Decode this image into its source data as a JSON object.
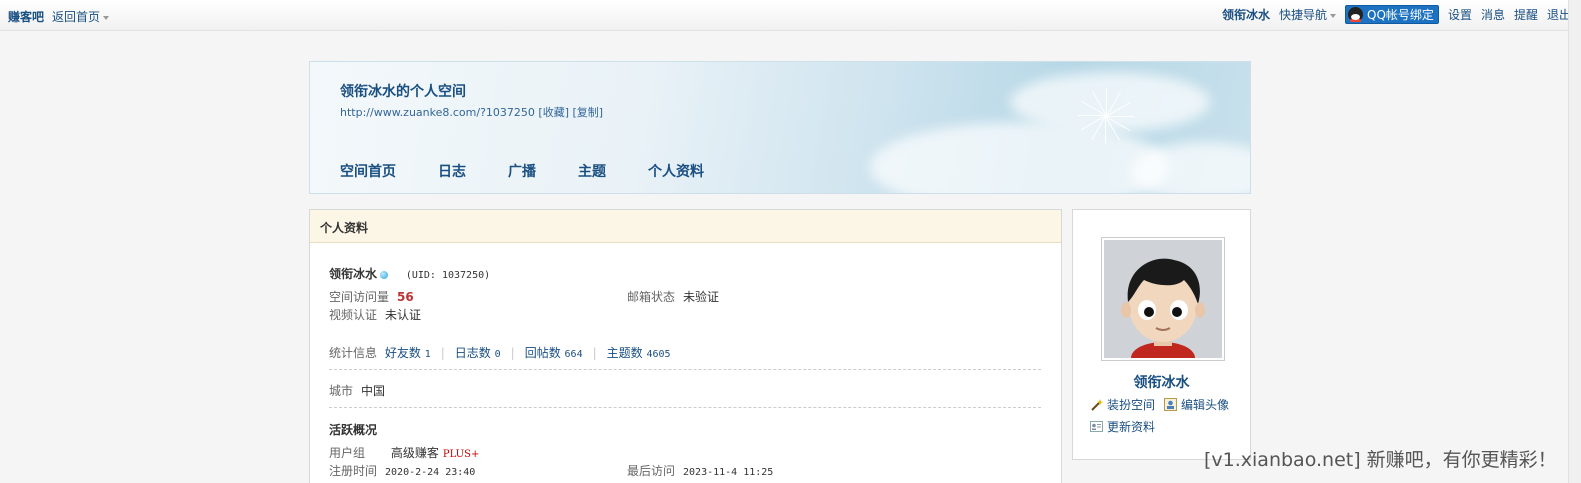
{
  "topbar": {
    "brand": "赚客吧",
    "home": "返回首页",
    "username": "领衔冰水",
    "quicknav": "快捷导航",
    "qq_bind": "QQ帐号绑定",
    "settings": "设置",
    "messages": "消息",
    "reminders": "提醒",
    "logout": "退出"
  },
  "banner": {
    "title": "领衔冰水的个人空间",
    "url": "http://www.zuanke8.com/?1037250",
    "favorite": "[收藏]",
    "copy": "[复制]",
    "nav": [
      "空间首页",
      "日志",
      "广播",
      "主题",
      "个人资料"
    ]
  },
  "profile": {
    "header": "个人资料",
    "username": "领衔冰水",
    "uid": "(UID: 1037250)",
    "visits_label": "空间访问量",
    "visits_value": "56",
    "email_label": "邮箱状态",
    "email_value": "未验证",
    "video_label": "视频认证",
    "video_value": "未认证",
    "stats_label": "统计信息",
    "stats": [
      {
        "label": "好友数",
        "value": "1"
      },
      {
        "label": "日志数",
        "value": "0"
      },
      {
        "label": "回帖数",
        "value": "664"
      },
      {
        "label": "主题数",
        "value": "4605"
      }
    ],
    "city_label": "城市",
    "city_value": "中国",
    "activity_title": "活跃概况",
    "group_label": "用户组",
    "group_value": "高级赚客",
    "group_badge": "PLUS+",
    "reg_label": "注册时间",
    "reg_value": "2020-2-24 23:40",
    "last_label": "最后访问",
    "last_value": "2023-11-4 11:25"
  },
  "sidebar": {
    "name": "领衔冰水",
    "decorate": "装扮空间",
    "edit_avatar": "编辑头像",
    "update_profile": "更新资料"
  },
  "watermark": "[v1.xianbao.net] 新赚吧，有你更精彩！"
}
